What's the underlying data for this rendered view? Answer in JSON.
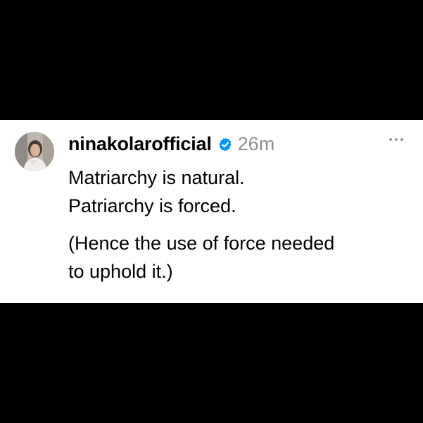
{
  "post": {
    "username": "ninakolarofficial",
    "verified_icon": "verified-badge-icon",
    "timestamp": "26m",
    "more_icon": "more-options-icon",
    "lines": [
      "Matriarchy is natural.",
      "Patriarchy is forced.",
      "(Hence the use of force needed",
      "to uphold it.)"
    ]
  },
  "colors": {
    "background": "#000000",
    "card": "#ffffff",
    "verified_blue": "#0095f6",
    "timestamp_gray": "#8e8e8e"
  }
}
